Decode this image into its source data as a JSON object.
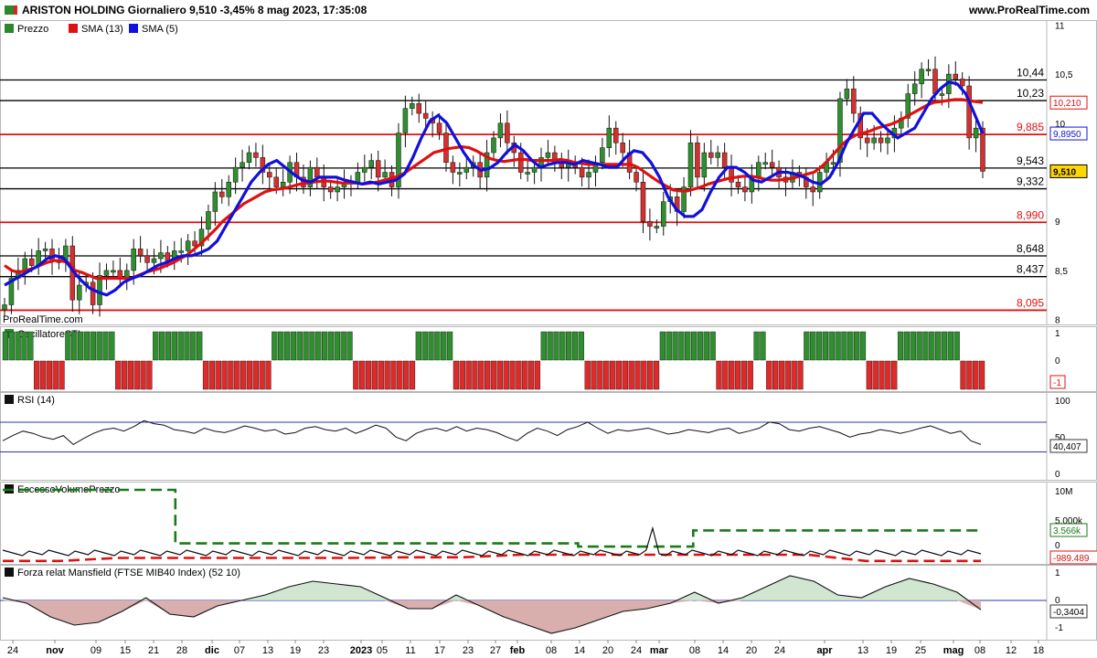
{
  "header": {
    "title": "ARISTON HOLDING Giornaliero 9,510 -3,45% 8 mag 2023, 17:35:08",
    "site": "www.ProRealTime.com",
    "watermark": "ProRealTime.com"
  },
  "x_labels": [
    "24",
    "nov",
    "09",
    "15",
    "21",
    "28",
    "dic",
    "07",
    "13",
    "19",
    "23",
    "2023",
    "05",
    "11",
    "17",
    "23",
    "27",
    "feb",
    "08",
    "14",
    "20",
    "24",
    "mar",
    "08",
    "14",
    "20",
    "24",
    "apr",
    "13",
    "19",
    "25",
    "mag",
    "08",
    "12",
    "18"
  ],
  "price_panel": {
    "legend": [
      {
        "label": "Prezzo",
        "color": "#2a8a2a"
      },
      {
        "label": "SMA (13)",
        "color": "#e01010"
      },
      {
        "label": "SMA (5)",
        "color": "#1010dd"
      }
    ],
    "yticks": [
      "11",
      "10,5",
      "10",
      "9",
      "8,5",
      "8"
    ],
    "hlines": [
      {
        "value": 10.44,
        "label": "10,44",
        "color": "#000000"
      },
      {
        "value": 10.23,
        "label": "10,23",
        "color": "#000000"
      },
      {
        "value": 9.885,
        "label": "9,885",
        "color": "#e01010"
      },
      {
        "value": 9.543,
        "label": "9,543",
        "color": "#000000"
      },
      {
        "value": 9.332,
        "label": "9,332",
        "color": "#000000"
      },
      {
        "value": 8.99,
        "label": "8,990",
        "color": "#e01010"
      },
      {
        "value": 8.648,
        "label": "8,648",
        "color": "#000000"
      },
      {
        "value": 8.437,
        "label": "8,437",
        "color": "#000000"
      },
      {
        "value": 8.095,
        "label": "8,095",
        "color": "#e01010"
      }
    ],
    "badges": [
      {
        "label": "10,210",
        "color": "#e01010",
        "value": 10.21
      },
      {
        "label": "9,8950",
        "color": "#1010dd",
        "value": 9.895
      },
      {
        "label": "9,510",
        "color": "#000000",
        "value": 9.51,
        "bg": "#ffd700"
      }
    ]
  },
  "sti_panel": {
    "legend": "OscillatoreSTI",
    "yticks": [
      "1",
      "0",
      "-1"
    ],
    "badge": "-1"
  },
  "rsi_panel": {
    "legend": "RSI (14)",
    "yticks": [
      "100",
      "50",
      "0"
    ],
    "badge": "40,407"
  },
  "vol_panel": {
    "legend": "EccessoVolumePrezzo",
    "yticks": [
      "10M",
      "5.000k",
      "0"
    ],
    "badges": [
      "3.566k",
      "-989.489"
    ]
  },
  "mans_panel": {
    "legend": "Forza relat Mansfield (FTSE MIB40 Index) (52 10)",
    "yticks": [
      "1",
      "0",
      "-1"
    ],
    "badge": "-0,3404"
  },
  "chart_data": {
    "type": "line",
    "title": "ARISTON HOLDING Giornaliero",
    "close": [
      8.15,
      8.42,
      8.5,
      8.62,
      8.55,
      8.7,
      8.72,
      8.6,
      8.58,
      8.75,
      8.2,
      8.35,
      8.38,
      8.15,
      8.45,
      8.5,
      8.5,
      8.42,
      8.5,
      8.72,
      8.65,
      8.58,
      8.62,
      8.68,
      8.6,
      8.7,
      8.7,
      8.8,
      8.75,
      8.92,
      9.1,
      9.3,
      9.25,
      9.4,
      9.55,
      9.6,
      9.7,
      9.65,
      9.5,
      9.45,
      9.35,
      9.4,
      9.6,
      9.45,
      9.35,
      9.55,
      9.45,
      9.35,
      9.3,
      9.35,
      9.4,
      9.4,
      9.5,
      9.55,
      9.62,
      9.45,
      9.5,
      9.35,
      9.9,
      10.15,
      10.2,
      10.1,
      10.05,
      10.0,
      9.9,
      9.6,
      9.5,
      9.5,
      9.55,
      9.6,
      9.45,
      9.7,
      9.85,
      10.0,
      9.8,
      9.7,
      9.5,
      9.5,
      9.55,
      9.65,
      9.7,
      9.6,
      9.55,
      9.6,
      9.55,
      9.45,
      9.5,
      9.6,
      9.75,
      9.95,
      9.8,
      9.7,
      9.5,
      9.4,
      9.0,
      8.95,
      8.95,
      9.2,
      9.25,
      9.1,
      9.35,
      9.8,
      9.45,
      9.7,
      9.65,
      9.7,
      9.55,
      9.4,
      9.35,
      9.3,
      9.45,
      9.6,
      9.6,
      9.55,
      9.45,
      9.4,
      9.5,
      9.45,
      9.35,
      9.3,
      9.5,
      9.6,
      9.6,
      10.25,
      10.35,
      10.1,
      9.85,
      9.8,
      9.85,
      9.8,
      9.85,
      9.95,
      10.05,
      10.3,
      10.4,
      10.55,
      10.55,
      10.3,
      10.3,
      10.5,
      10.45,
      10.38,
      9.85,
      9.95,
      9.51
    ],
    "sma13": [
      8.55,
      8.5,
      8.48,
      8.5,
      8.52,
      8.55,
      8.58,
      8.6,
      8.6,
      8.58,
      8.5,
      8.48,
      8.45,
      8.42,
      8.42,
      8.42,
      8.42,
      8.42,
      8.42,
      8.45,
      8.48,
      8.5,
      8.52,
      8.55,
      8.58,
      8.62,
      8.66,
      8.72,
      8.78,
      8.85,
      8.92,
      9.0,
      9.06,
      9.12,
      9.18,
      9.22,
      9.26,
      9.3,
      9.32,
      9.33,
      9.34,
      9.36,
      9.38,
      9.39,
      9.4,
      9.41,
      9.41,
      9.4,
      9.39,
      9.39,
      9.39,
      9.38,
      9.39,
      9.4,
      9.42,
      9.44,
      9.46,
      9.5,
      9.55,
      9.6,
      9.65,
      9.7,
      9.72,
      9.74,
      9.75,
      9.76,
      9.75,
      9.72,
      9.68,
      9.64,
      9.62,
      9.61,
      9.62,
      9.63,
      9.63,
      9.62,
      9.62,
      9.62,
      9.62,
      9.63,
      9.62,
      9.6,
      9.59,
      9.58,
      9.58,
      9.58,
      9.58,
      9.58,
      9.58,
      9.58,
      9.55,
      9.5,
      9.45,
      9.4,
      9.36,
      9.32,
      9.31,
      9.31,
      9.33,
      9.35,
      9.38,
      9.4,
      9.42,
      9.44,
      9.45,
      9.46,
      9.46,
      9.45,
      9.43,
      9.42,
      9.42,
      9.43,
      9.44,
      9.46,
      9.48,
      9.5,
      9.55,
      9.62,
      9.7,
      9.78,
      9.84,
      9.88,
      9.9,
      9.92,
      9.95,
      9.97,
      9.99,
      10.02,
      10.06,
      10.1,
      10.14,
      10.18,
      10.21,
      10.22,
      10.23,
      10.24,
      10.24,
      10.23,
      10.22,
      10.21
    ],
    "sma5": [
      8.35,
      8.4,
      8.45,
      8.5,
      8.55,
      8.62,
      8.65,
      8.62,
      8.5,
      8.4,
      8.32,
      8.28,
      8.25,
      8.3,
      8.38,
      8.42,
      8.45,
      8.5,
      8.55,
      8.58,
      8.62,
      8.65,
      8.65,
      8.68,
      8.72,
      8.8,
      8.95,
      9.1,
      9.25,
      9.4,
      9.5,
      9.58,
      9.62,
      9.55,
      9.48,
      9.42,
      9.4,
      9.45,
      9.45,
      9.45,
      9.42,
      9.4,
      9.38,
      9.4,
      9.38,
      9.4,
      9.42,
      9.48,
      9.65,
      9.85,
      10.02,
      10.08,
      10.0,
      9.85,
      9.7,
      9.58,
      9.52,
      9.54,
      9.6,
      9.7,
      9.78,
      9.72,
      9.62,
      9.55,
      9.58,
      9.6,
      9.6,
      9.58,
      9.62,
      9.6,
      9.58,
      9.55,
      9.55,
      9.65,
      9.72,
      9.7,
      9.6,
      9.45,
      9.25,
      9.12,
      9.05,
      9.05,
      9.12,
      9.3,
      9.45,
      9.55,
      9.55,
      9.5,
      9.42,
      9.4,
      9.45,
      9.5,
      9.5,
      9.48,
      9.45,
      9.4,
      9.38,
      9.45,
      9.6,
      9.8,
      9.95,
      10.1,
      10.1,
      10.0,
      9.92,
      9.85,
      9.9,
      9.95,
      10.1,
      10.25,
      10.35,
      10.42,
      10.4,
      10.3,
      10.1,
      9.895
    ],
    "sti": [
      1,
      1,
      1,
      1,
      1,
      -1,
      -1,
      -1,
      -1,
      -1,
      1,
      1,
      1,
      1,
      1,
      1,
      1,
      1,
      -1,
      -1,
      -1,
      -1,
      -1,
      -1,
      1,
      1,
      1,
      1,
      1,
      1,
      1,
      1,
      -1,
      -1,
      -1,
      -1,
      -1,
      -1,
      -1,
      -1,
      -1,
      -1,
      -1,
      1,
      1,
      1,
      1,
      1,
      1,
      1,
      1,
      1,
      1,
      1,
      1,
      1,
      -1,
      -1,
      -1,
      -1,
      -1,
      -1,
      -1,
      -1,
      -1,
      -1,
      1,
      1,
      1,
      1,
      1,
      1,
      -1,
      -1,
      -1,
      -1,
      -1,
      -1,
      -1,
      -1,
      -1,
      -1,
      -1,
      -1,
      -1,
      -1,
      1,
      1,
      1,
      1,
      1,
      1,
      1,
      -1,
      -1,
      -1,
      -1,
      -1,
      -1,
      -1,
      -1,
      -1,
      -1,
      -1,
      -1,
      1,
      1,
      1,
      1,
      1,
      1,
      1,
      1,
      1,
      -1,
      -1,
      -1,
      -1,
      -1,
      -1,
      1,
      1,
      -1,
      -1,
      -1,
      -1,
      -1,
      -1,
      1,
      1,
      1,
      1,
      1,
      1,
      1,
      1,
      1,
      1,
      -1,
      -1,
      -1,
      -1,
      -1,
      1,
      1,
      1,
      1,
      1,
      1,
      1,
      1,
      1,
      1,
      -1,
      -1,
      -1,
      -1
    ],
    "rsi": [
      45,
      52,
      58,
      55,
      50,
      47,
      52,
      40,
      48,
      55,
      60,
      62,
      58,
      64,
      72,
      68,
      66,
      60,
      58,
      55,
      62,
      58,
      56,
      60,
      65,
      62,
      58,
      60,
      54,
      56,
      62,
      64,
      60,
      58,
      62,
      55,
      60,
      66,
      62,
      50,
      45,
      55,
      60,
      62,
      58,
      64,
      58,
      62,
      60,
      56,
      50,
      45,
      55,
      62,
      58,
      52,
      60,
      64,
      70,
      62,
      55,
      60,
      58,
      60,
      62,
      58,
      54,
      56,
      60,
      58,
      56,
      60,
      62,
      55,
      58,
      62,
      70,
      68,
      60,
      58,
      62,
      64,
      60,
      56,
      50,
      54,
      56,
      60,
      58,
      55,
      58,
      62,
      65,
      60,
      55,
      58,
      45,
      40
    ],
    "evp_short": [
      -0.99,
      -0.99,
      -0.5,
      -0.5,
      -0.5,
      -0.5,
      -0.5,
      -0.4,
      -0.4,
      0.0,
      0.0,
      0.0,
      0.0,
      0.0,
      0.0,
      -0.99,
      -0.99,
      -0.99
    ],
    "evp_long": [
      10,
      10,
      10,
      1.5,
      1.5,
      1.5,
      1.5,
      1.5,
      1.5,
      1.5,
      1.0,
      1.0,
      3.566,
      3.566,
      3.566,
      3.566,
      3.566,
      3.566
    ],
    "mansfield": [
      0.1,
      -0.1,
      -0.6,
      -0.9,
      -0.8,
      -0.4,
      0.1,
      -0.5,
      -0.6,
      -0.2,
      0.0,
      0.2,
      0.5,
      0.7,
      0.6,
      0.5,
      0.1,
      -0.3,
      -0.3,
      0.2,
      -0.2,
      -0.6,
      -0.9,
      -1.2,
      -1.0,
      -0.7,
      -0.4,
      -0.3,
      -0.1,
      0.3,
      -0.1,
      0.1,
      0.5,
      0.9,
      0.7,
      0.2,
      0.1,
      0.5,
      0.8,
      0.6,
      0.3,
      -0.34
    ]
  }
}
